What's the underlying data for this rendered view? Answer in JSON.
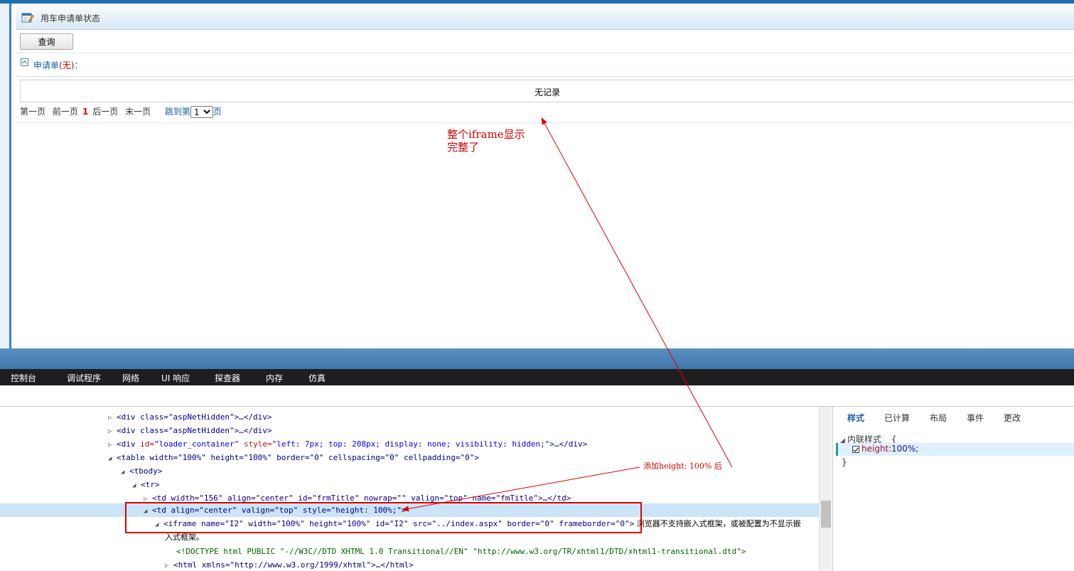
{
  "page": {
    "title": "用车申请单状态",
    "query_button": "查询",
    "application_label": "申请单",
    "application_status": "(无)",
    "application_colon": "：",
    "empty_text": "无记录",
    "pager": {
      "first": "第一页",
      "prev": "前一页",
      "current": "1",
      "next": "后一页",
      "last": "末一页",
      "jump_prefix": "跳到第",
      "jump_value": "1",
      "jump_suffix": "页"
    }
  },
  "devtools": {
    "tabs": [
      "控制台",
      "调试程序",
      "网络",
      "UI 响应",
      "探查器",
      "内存",
      "仿真"
    ],
    "dom": {
      "l1": "<div class=\"aspNetHidden\">…</div>",
      "l2": "<div class=\"aspNetHidden\">…</div>",
      "l3a": "<div ",
      "l3b": "id=",
      "l3c": "\"loader_container\"",
      "l3d": " style=",
      "l3e": "\"left: 7px; top: 208px; display: none; visibility: hidden;\"",
      "l3f": ">…</div>",
      "l4": "<table width=\"100%\" height=\"100%\" border=\"0\" cellspacing=\"0\" cellpadding=\"0\">",
      "l5": "<tbody>",
      "l6": "<tr>",
      "l7": "<td width=\"156\" align=\"center\" id=\"frmTitle\" nowrap=\"\" valign=\"top\" name=\"fmTitle\">…</td>",
      "l8": "<td align=\"center\" valign=\"top\" style=\"height: 100%;\">",
      "l9": "<iframe name=\"I2\" width=\"100%\" height=\"100%\" id=\"I2\" src=\"../index.aspx\" border=\"0\" frameborder=\"0\">",
      "l9_text": " 浏览器不支持嵌入式框架，或被配置为不显示嵌",
      "l10": "入式框架。",
      "l11": "<!DOCTYPE html PUBLIC \"-//W3C//DTD XHTML 1.0 Transitional//EN\" \"http://www.w3.org/TR/xhtml1/DTD/xhtml1-transitional.dtd\">",
      "l12": "<html xmlns=\"http://www.w3.org/1999/xhtml\">…</html>"
    },
    "style_tabs": [
      "样式",
      "已计算",
      "布局",
      "事件",
      "更改"
    ],
    "inline_style_label": "内联样式",
    "open_brace": "{",
    "close_brace": "}",
    "prop_name": "height:",
    "prop_value": "100%;"
  },
  "annotations": {
    "note1_line1": "整个iframe显示",
    "note1_line2": "完整了",
    "note2": "添加height: 100% 后",
    "color": "#d40000"
  }
}
